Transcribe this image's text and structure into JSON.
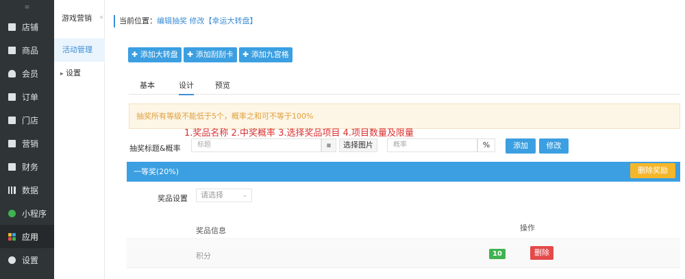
{
  "sidebar": {
    "top_mark": "≡",
    "items": [
      {
        "label": "店铺",
        "icon": "shop-icon"
      },
      {
        "label": "商品",
        "icon": "product-icon"
      },
      {
        "label": "会员",
        "icon": "member-icon"
      },
      {
        "label": "订单",
        "icon": "order-icon"
      },
      {
        "label": "门店",
        "icon": "store-icon"
      },
      {
        "label": "营销",
        "icon": "marketing-icon"
      },
      {
        "label": "财务",
        "icon": "finance-icon"
      },
      {
        "label": "数据",
        "icon": "data-icon"
      },
      {
        "label": "小程序",
        "icon": "miniprogram-icon"
      },
      {
        "label": "应用",
        "icon": "apps-icon"
      },
      {
        "label": "设置",
        "icon": "settings-icon"
      }
    ],
    "active_label": "应用"
  },
  "submenu": {
    "title": "游戏营销",
    "active_item": "活动管理",
    "settings_item": "设置",
    "collapse_glyph": "«",
    "settings_caret": "▸"
  },
  "breadcrumb": {
    "prefix": "当前位置：",
    "link1": "编辑抽奖",
    "link2": "修改",
    "link3": "【幸运大转盘】"
  },
  "toolbar": {
    "add_wheel": "✚ 添加大转盘",
    "add_scratch": "✚ 添加刮刮卡",
    "add_grid": "✚ 添加九宫格"
  },
  "tabs": [
    "基本",
    "设计",
    "预览"
  ],
  "warning": "抽奖所有等级不能低于5个，概率之和可不等于100%",
  "annotation": "1.奖品名称 2.中奖概率 3.选择奖品项目  4.项目数量及限量",
  "form": {
    "label": "抽奖标题&概率",
    "title_placeholder": "标题",
    "image_icon": "▪",
    "choose_image": "选择图片",
    "rate_placeholder": "概率",
    "percent": "%",
    "add_button": "添加",
    "modify_button": "修改"
  },
  "prize_panel": {
    "title": "一等奖(20%)",
    "delete_button": "删除奖励",
    "setting_label": "奖品设置",
    "select_value": "请选择",
    "select_caret": "⌄",
    "columns": [
      "奖品信息",
      "操作"
    ],
    "rows": [
      {
        "name": "积分",
        "value": "10",
        "action": "删除"
      }
    ]
  },
  "colors": {
    "primary": "#3b9fe1",
    "warning": "#f5b62a",
    "danger": "#e4494a",
    "success": "#3fb34f",
    "sidebar_bg": "#2f3437"
  }
}
